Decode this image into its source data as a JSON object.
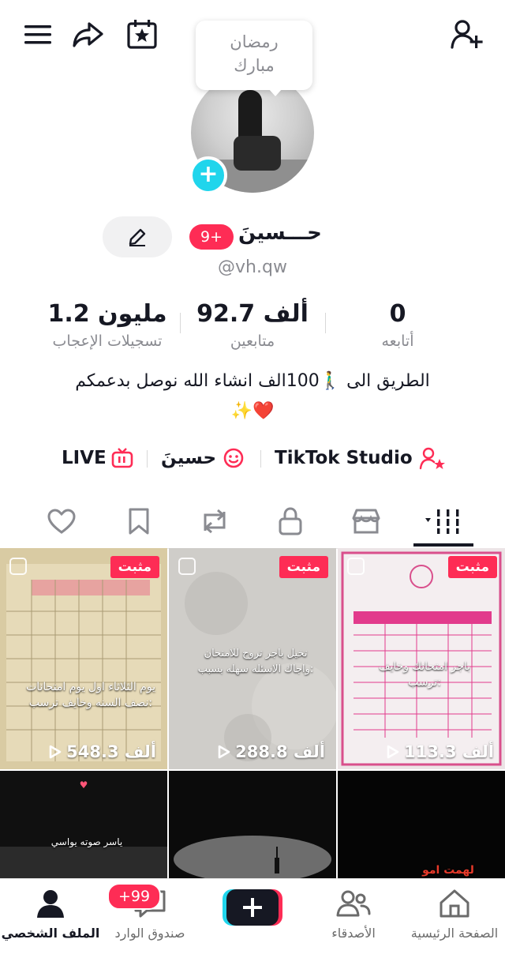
{
  "bubble": {
    "line1": "رمضان",
    "line2": "مبارك"
  },
  "profile": {
    "name": "حـــسينَ",
    "badge": "9+",
    "handle": "@vh.qw"
  },
  "stats": [
    {
      "number": "1.2 مليون",
      "label": "تسجيلات الإعجاب"
    },
    {
      "number": "92.7 ألف",
      "label": "متابعين"
    },
    {
      "number": "0",
      "label": "أتابعه"
    }
  ],
  "bio": {
    "line1": "الطريق الى 🚶‍♂️100الف انشاء الله نوصل بدعمكم",
    "line2": "✨❤️"
  },
  "links": {
    "live": "LIVE",
    "nickname": "حسينَ",
    "studio": "TikTok Studio"
  },
  "videos": [
    {
      "views": "548.3 ألف",
      "pinned": "مثبت",
      "caption": "يوم الثلاثاء اول يوم امتحانات نصف السنه وخايف ترسب:",
      "bg": "#d9cba3"
    },
    {
      "views": "288.8 ألف",
      "pinned": "مثبت",
      "caption": "تخيل باجر تروح للامتحان واجاك الاسئله سهله بسبب:",
      "bg": "#c9c7c3"
    },
    {
      "views": "113.3 ألف",
      "pinned": "مثبت",
      "caption": "باجر امتحانك وخايف ترسب:",
      "bg": "#ece4e6"
    },
    {
      "caption": "ياسر صوته يواسي",
      "bg": "#111111"
    },
    {
      "bg": "#0b0b0b"
    },
    {
      "caption": "لهمت امو",
      "bg": "#050505"
    }
  ],
  "nav": {
    "home": "الصفحة الرئيسية",
    "friends": "الأصدقاء",
    "inbox": "صندوق الوارد",
    "inbox_badge": "+99",
    "profile": "الملف الشخصي"
  },
  "colors": {
    "accent": "#fe2c55",
    "cyan": "#20d5ec",
    "text": "#161823",
    "muted": "#8a8b91"
  },
  "icons": [
    "menu-icon",
    "share-icon",
    "calendar-star-icon",
    "add-friend-icon",
    "pencil-icon",
    "heart-icon",
    "bookmark-icon",
    "repost-icon",
    "lock-icon",
    "shop-icon",
    "grid-icon",
    "live-icon",
    "smile-icon",
    "studio-icon",
    "home-icon",
    "friends-icon",
    "inbox-icon",
    "plus-icon",
    "profile-icon"
  ]
}
